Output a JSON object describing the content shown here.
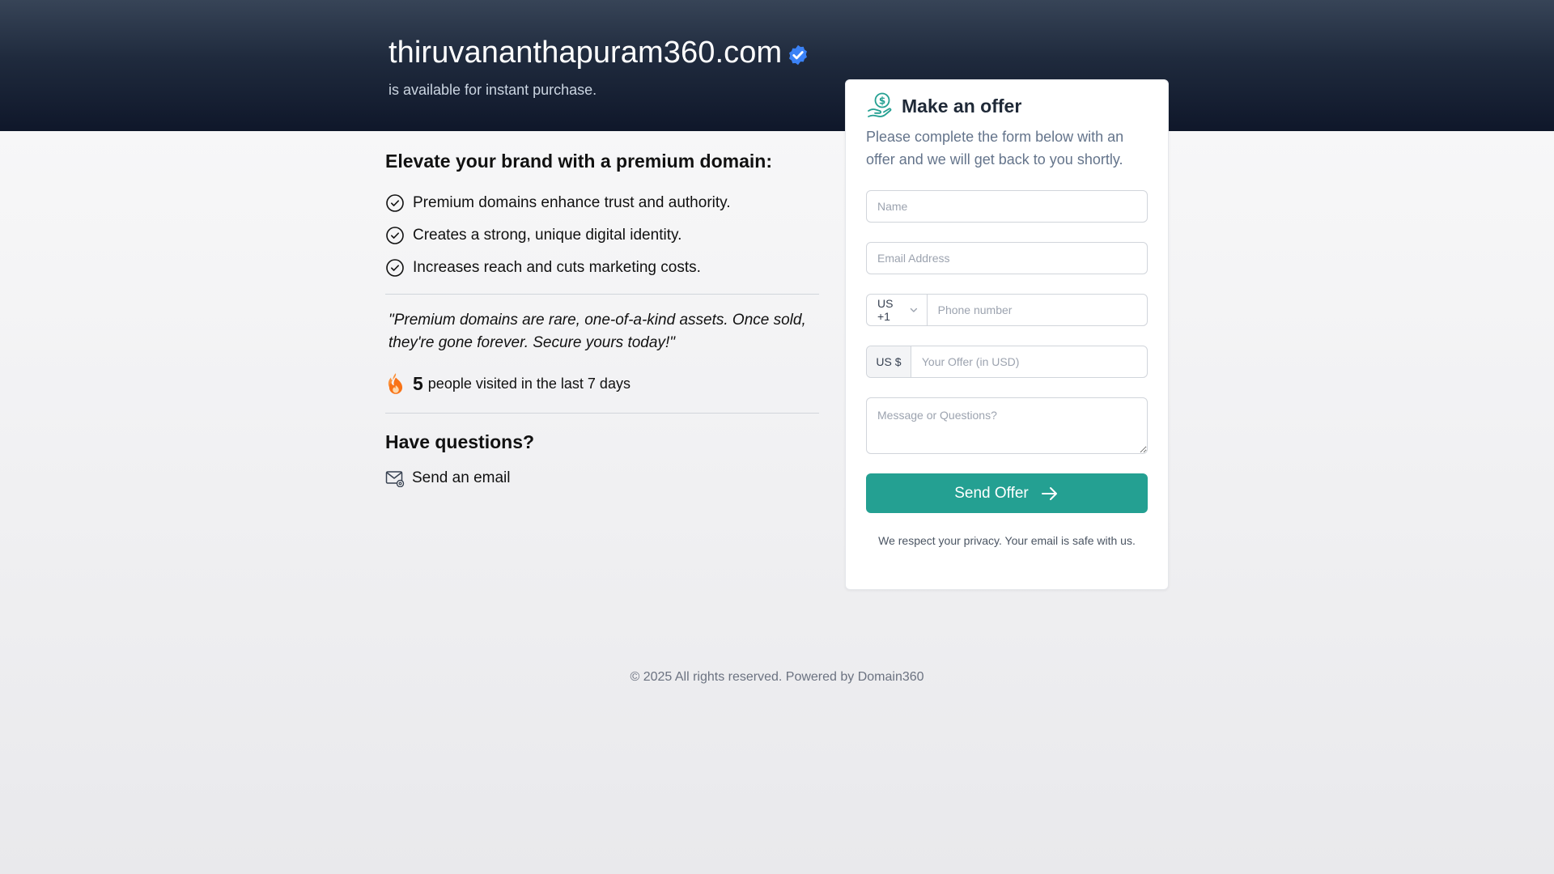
{
  "hero": {
    "domain": "thiruvananthapuram360.com",
    "subtitle": "is available for instant purchase."
  },
  "benefits": {
    "heading": "Elevate your brand with a premium domain:",
    "items": [
      "Premium domains enhance trust and authority.",
      "Creates a strong, unique digital identity.",
      "Increases reach and cuts marketing costs."
    ]
  },
  "quote": "\"Premium domains are rare, one-of-a-kind assets. Once sold, they're gone forever. Secure yours today!\"",
  "visits": {
    "count": "5",
    "text": "people visited in the last 7 days"
  },
  "questions": {
    "heading": "Have questions?",
    "email_label": "Send an email"
  },
  "offer_form": {
    "title": "Make an offer",
    "description": "Please complete the form below with an offer and we will get back to you shortly.",
    "name_placeholder": "Name",
    "email_placeholder": "Email Address",
    "country_code": "US +1",
    "phone_placeholder": "Phone number",
    "currency": "US $",
    "offer_placeholder": "Your Offer (in USD)",
    "message_placeholder": "Message or Questions?",
    "submit_label": "Send Offer",
    "privacy_note": "We respect your privacy. Your email is safe with us."
  },
  "footer": {
    "text": "© 2025 All rights reserved. Powered by Domain360"
  },
  "colors": {
    "accent": "#24a092",
    "verified": "#3b82f6",
    "flame": "#f97316",
    "hero_dark": "#0f172a"
  },
  "icons": [
    "verified-badge-icon",
    "check-circle-icon",
    "flame-icon",
    "mail-icon",
    "money-hand-icon",
    "chevron-down-icon",
    "arrow-right-icon"
  ]
}
